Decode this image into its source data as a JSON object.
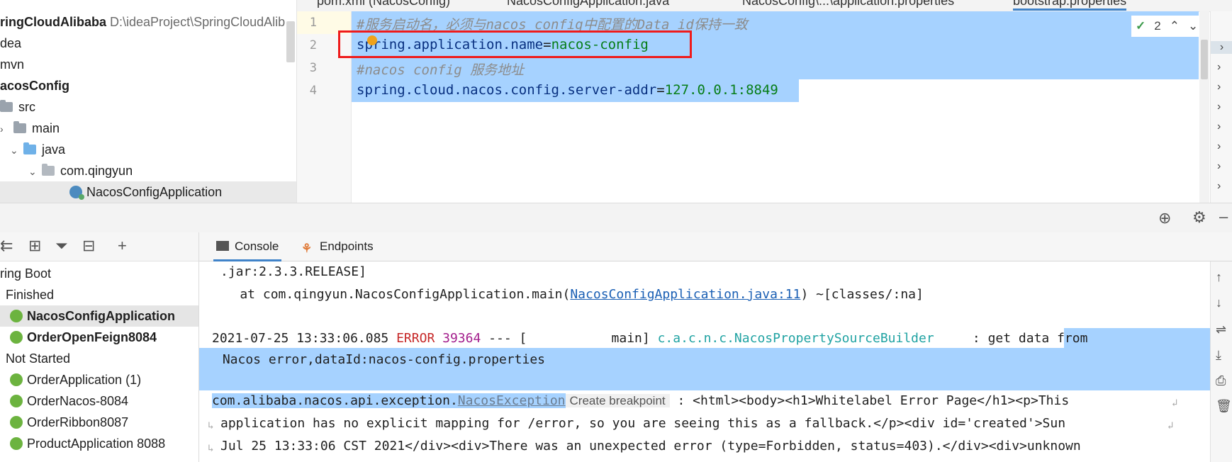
{
  "project": {
    "root_name": "ringCloudAlibaba",
    "root_path": "D:\\ideaProject\\SpringCloudAlib",
    "items": [
      {
        "label": "dea"
      },
      {
        "label": "mvn"
      },
      {
        "label": "acosConfig"
      },
      {
        "label": "src"
      },
      {
        "label": "main"
      },
      {
        "label": "java"
      },
      {
        "label": "com.qingyun"
      },
      {
        "label": "NacosConfigApplication"
      }
    ]
  },
  "editor": {
    "tabs": [
      {
        "label": "pom.xml (NacosConfig)"
      },
      {
        "label": "NacosConfigApplication.java"
      },
      {
        "label": "NacosConfig\\...\\application.properties"
      },
      {
        "label": "bootstrap.properties"
      }
    ],
    "line_numbers": [
      "1",
      "2",
      "3",
      "4"
    ],
    "lines": {
      "l1_comment": "#服务启动名，必须与nacos config中配置的Data id保持一致",
      "l2_key": "spring.application.name",
      "l2_eq": "=",
      "l2_value": "nacos-config",
      "l3_comment": "#nacos config 服务地址",
      "l4_key": "spring.cloud.nacos.config.server-addr",
      "l4_eq": "=",
      "l4_value": "127.0.0.1:8849"
    },
    "inspection_count": "2"
  },
  "services": {
    "tree": [
      {
        "label": "ring Boot"
      },
      {
        "label": "Finished"
      },
      {
        "label": "NacosConfigApplication"
      },
      {
        "label": "OrderOpenFeign8084"
      },
      {
        "label": "Not Started"
      },
      {
        "label": "OrderApplication (1)"
      },
      {
        "label": "OrderNacos-8084"
      },
      {
        "label": "OrderRibbon8087"
      },
      {
        "label": "ProductApplication 8088"
      }
    ]
  },
  "console": {
    "tabs": [
      {
        "label": "Console"
      },
      {
        "label": "Endpoints"
      }
    ],
    "lines": {
      "l1": ".jar:2.3.3.RELEASE]",
      "l2_prefix": "    at com.qingyun.NacosConfigApplication.main(",
      "l2_link": "NacosConfigApplication.java:11",
      "l2_suffix": ") ~[classes/:na]",
      "l3_time": "2021-07-25 13:33:06.085 ",
      "l3_level": "ERROR",
      "l3_pid": " 39364",
      "l3_mid": " --- [           main] ",
      "l3_logger": "c.a.c.n.c.NacosPropertySourceBuilder",
      "l3_colon": "     : ",
      "l3_msg": "get data from",
      "l4": " Nacos error,dataId:nacos-config.properties",
      "l5_prefix": "com.alibaba.nacos.api.exception.",
      "l5_link": "NacosException",
      "l5_hint": "Create breakpoint",
      "l5_suffix": " : <html><body><h1>Whitelabel Error Page</h1><p>This",
      "l6": "application has no explicit mapping for /error, so you are seeing this as a fallback.</p><div id='created'>Sun",
      "l7": "Jul 25 13:33:06 CST 2021</div><div>There was an unexpected error (type=Forbidden, status=403).</div><div>unknown"
    }
  },
  "colors": {
    "selection": "#a6d2ff",
    "highlight_box": "#ef1b1b",
    "error": "#c62828",
    "link": "#1a5fb4"
  }
}
